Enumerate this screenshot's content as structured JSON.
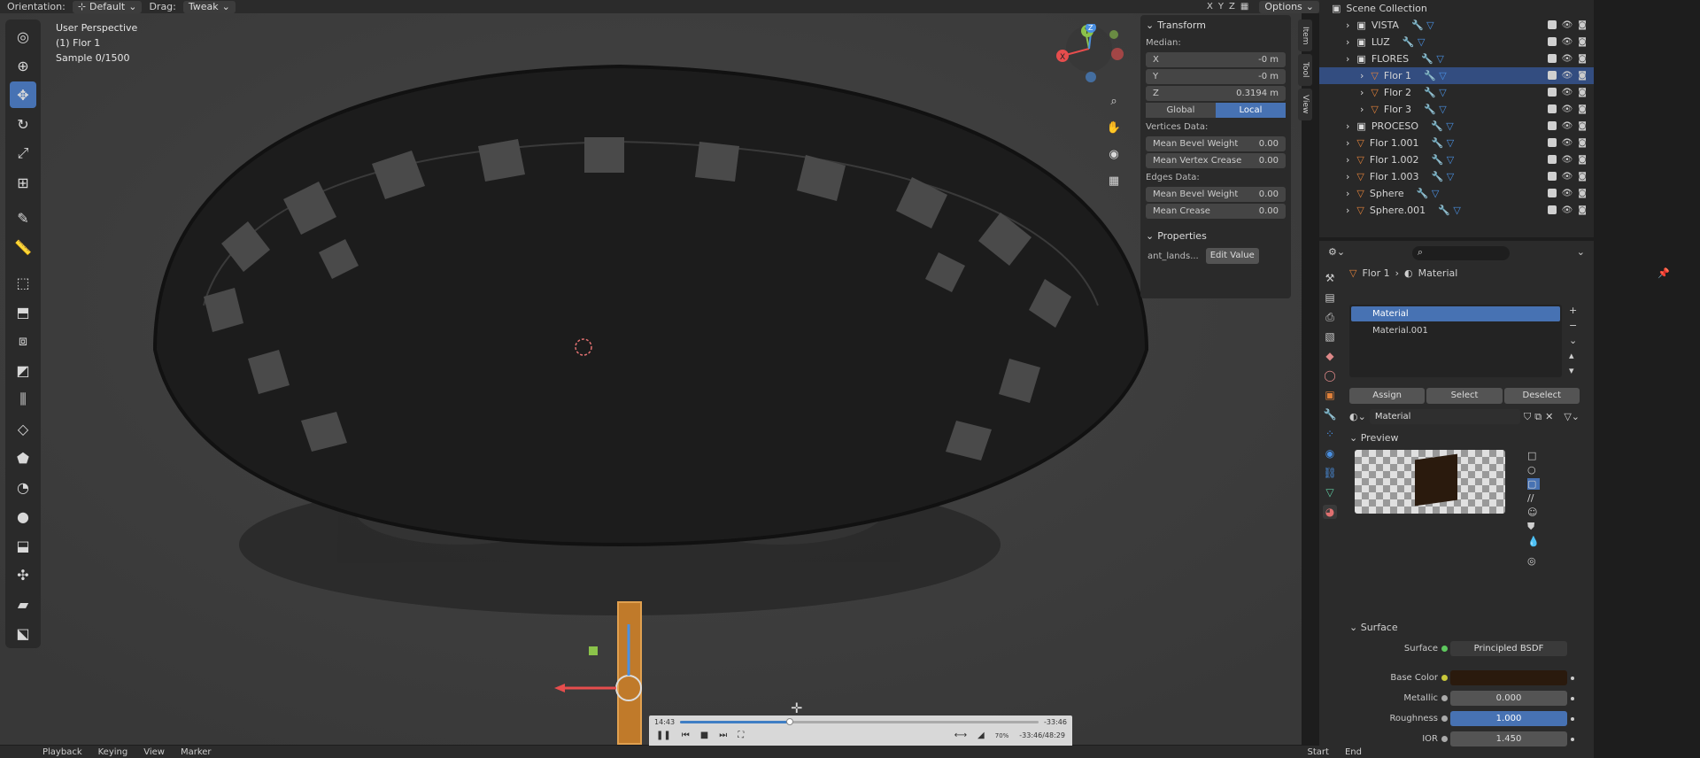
{
  "header": {
    "orientation_label": "Orientation:",
    "orientation_value": "Default",
    "drag_label": "Drag:",
    "drag_value": "Tweak",
    "axes": [
      "X",
      "Y",
      "Z"
    ],
    "options_label": "Options"
  },
  "viewport": {
    "perspective": "User Perspective",
    "object": "(1) Flor 1",
    "sample": "Sample 0/1500"
  },
  "npanel": {
    "transform_title": "Transform",
    "median_label": "Median:",
    "x_label": "X",
    "x_value": "-0 m",
    "y_label": "Y",
    "y_value": "-0 m",
    "z_label": "Z",
    "z_value": "0.3194 m",
    "global_label": "Global",
    "local_label": "Local",
    "vertices_label": "Vertices Data:",
    "mean_bevel_label": "Mean Bevel Weight",
    "mean_bevel_value": "0.00",
    "mean_vcrease_label": "Mean Vertex Crease",
    "mean_vcrease_value": "0.00",
    "edges_label": "Edges Data:",
    "edge_bevel_label": "Mean Bevel Weight",
    "edge_bevel_value": "0.00",
    "edge_crease_label": "Mean Crease",
    "edge_crease_value": "0.00",
    "properties_title": "Properties",
    "prop_name": "ant_lands...",
    "edit_value_label": "Edit Value",
    "tabs": [
      "Item",
      "Tool",
      "View"
    ]
  },
  "outliner": {
    "root": "Scene Collection",
    "items": [
      {
        "label": "VISTA",
        "indent": 1,
        "selected": false
      },
      {
        "label": "LUZ",
        "indent": 1,
        "selected": false
      },
      {
        "label": "FLORES",
        "indent": 1,
        "selected": false
      },
      {
        "label": "Flor 1",
        "indent": 2,
        "selected": true
      },
      {
        "label": "Flor 2",
        "indent": 2,
        "selected": false
      },
      {
        "label": "Flor 3",
        "indent": 2,
        "selected": false
      },
      {
        "label": "PROCESO",
        "indent": 1,
        "selected": false
      },
      {
        "label": "Flor 1.001",
        "indent": 1,
        "selected": false
      },
      {
        "label": "Flor 1.002",
        "indent": 1,
        "selected": false
      },
      {
        "label": "Flor 1.003",
        "indent": 1,
        "selected": false
      },
      {
        "label": "Sphere",
        "indent": 1,
        "selected": false
      },
      {
        "label": "Sphere.001",
        "indent": 1,
        "selected": false
      }
    ]
  },
  "properties": {
    "breadcrumb_object": "Flor 1",
    "breadcrumb_section": "Material",
    "slots": [
      "Material",
      "Material.001"
    ],
    "assign_label": "Assign",
    "select_label": "Select",
    "deselect_label": "Deselect",
    "material_name": "Material",
    "preview_title": "Preview",
    "surface_title": "Surface",
    "surface_label": "Surface",
    "surface_value": "Principled BSDF",
    "base_color_label": "Base Color",
    "base_color": "#2a1a0d",
    "metallic_label": "Metallic",
    "metallic_value": "0.000",
    "roughness_label": "Roughness",
    "roughness_value": "1.000",
    "ior_label": "IOR",
    "ior_value": "1.450"
  },
  "media": {
    "time_elapsed": "14:43",
    "time_remaining": "-33:46",
    "time_total": "-33:46/48:29",
    "progress": 0.305,
    "volume_label": "70%"
  },
  "timeline": {
    "items": [
      "Playback",
      "Keying",
      "View",
      "Marker"
    ],
    "start_label": "Start",
    "end_label": "End"
  },
  "colors": {
    "accent": "#4772b3",
    "selection": "#334d80",
    "object_orange": "#e0813a",
    "mesh_green": "#5ec8a1",
    "axis_x": "#e64d4d",
    "axis_y": "#8bc34a",
    "axis_z": "#4a90e2"
  }
}
